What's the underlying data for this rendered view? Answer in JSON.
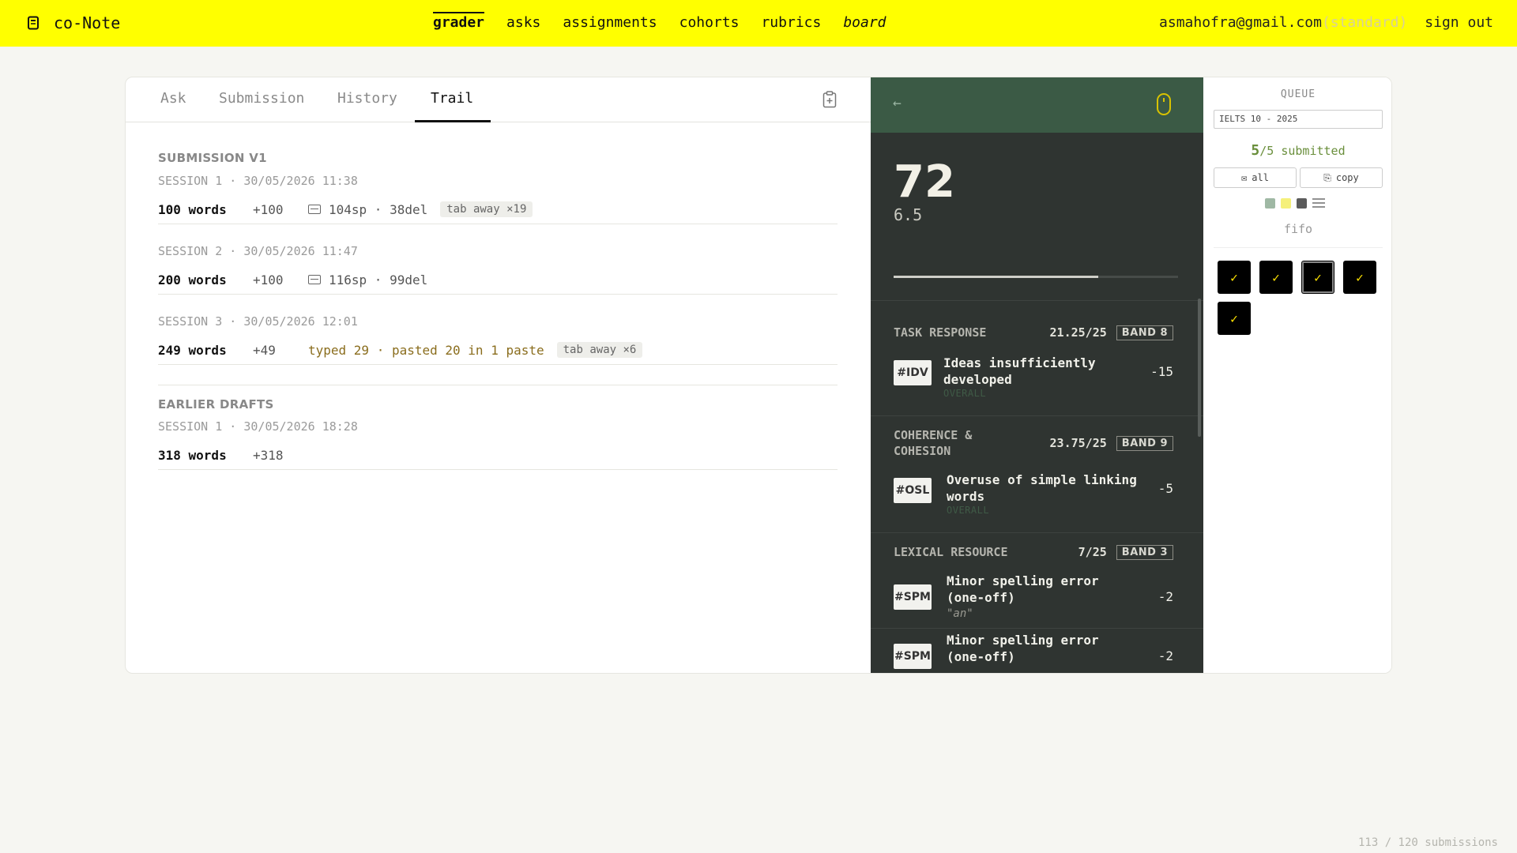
{
  "app": {
    "name": "co-Note"
  },
  "nav": {
    "items": [
      "grader",
      "asks",
      "assignments",
      "cohorts",
      "rubrics",
      "board"
    ]
  },
  "account": {
    "email": "asmahofra@gmail.com",
    "plan": "(standard)",
    "sign_out": "sign out"
  },
  "tabs": [
    "Ask",
    "Submission",
    "History",
    "Trail"
  ],
  "trail": {
    "section1": "SUBMISSION V1",
    "s1": {
      "label": "SESSION 1 · 30/05/2026 11:38",
      "words": "100 words",
      "delta": "+100",
      "keys": "104sp · 38del",
      "badge": "tab away ×19"
    },
    "s2": {
      "label": "SESSION 2 · 30/05/2026 11:47",
      "words": "200 words",
      "delta": "+100",
      "keys": "116sp · 99del"
    },
    "s3": {
      "label": "SESSION 3 · 30/05/2026 12:01",
      "words": "249 words",
      "delta": "+49",
      "paste": "typed 29 · pasted 20 in 1 paste",
      "badge": "tab away ×6"
    },
    "section2": "EARLIER DRAFTS",
    "e1": {
      "label": "SESSION 1 · 30/05/2026 18:28",
      "words": "318 words",
      "delta": "+318"
    }
  },
  "grade": {
    "score": "72",
    "band": "6.5",
    "progress": 0.72,
    "criteria": [
      {
        "name": "TASK RESPONSE",
        "score": "21.25/25",
        "band": "BAND 8"
      },
      {
        "name": "COHERENCE & COHESION",
        "score": "23.75/25",
        "band": "BAND 9"
      },
      {
        "name": "LEXICAL RESOURCE",
        "score": "7/25",
        "band": "BAND 3"
      }
    ],
    "items": [
      {
        "tag": "#IDV",
        "text": "Ideas insufficiently developed",
        "points": "-15",
        "sub": "OVERALL"
      },
      {
        "tag": "#OSL",
        "text": "Overuse of simple linking words",
        "points": "-5",
        "sub": "OVERALL"
      },
      {
        "tag": "#SPM",
        "text": "Minor spelling error (one-off)",
        "points": "-2",
        "quote": "\"an\""
      },
      {
        "tag": "#SPM",
        "text": "Minor spelling error (one-off)",
        "points": "-2"
      }
    ]
  },
  "queue": {
    "title": "QUEUE",
    "selector": "IELTS 10 - 2025",
    "submitted_num": "5",
    "submitted_total": "/5",
    "submitted_label": " submitted",
    "btn_all": "all",
    "btn_copy": "copy",
    "order": "fifo",
    "swatch_colors": [
      "#9fb8a4",
      "#f5f07a",
      "#5b5b5b"
    ],
    "items": [
      "✓",
      "✓",
      "✓",
      "✓",
      "✓"
    ]
  },
  "footer": "113 / 120 submissions"
}
